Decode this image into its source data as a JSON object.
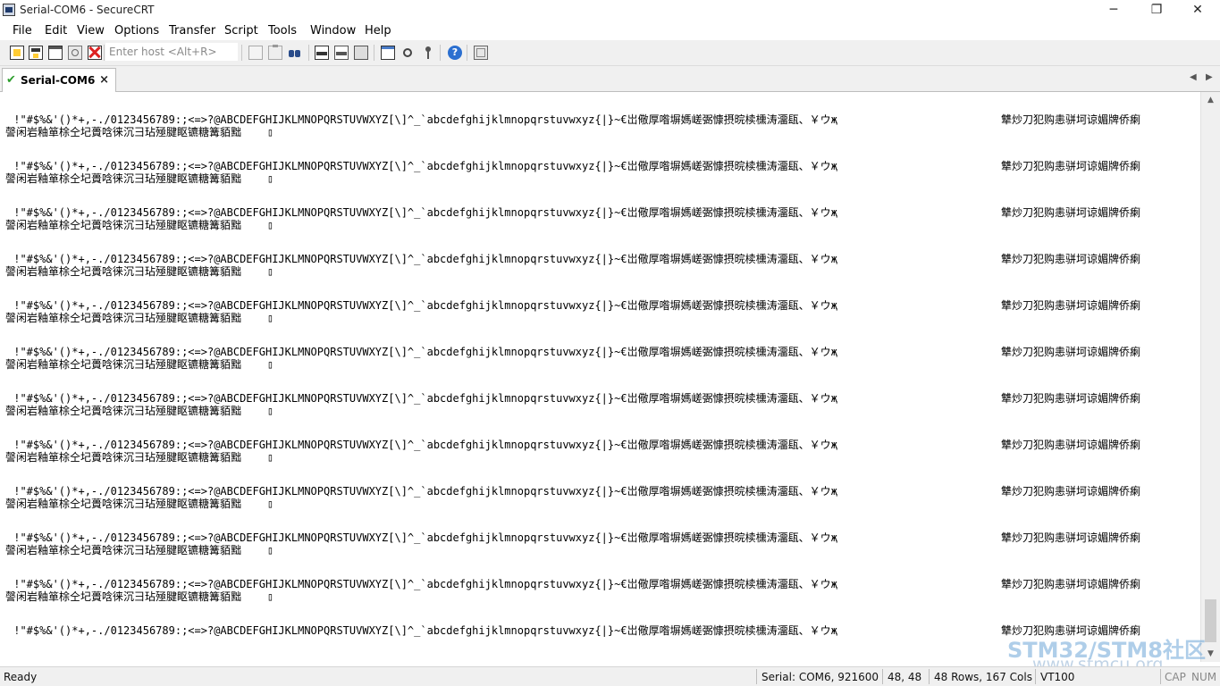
{
  "window": {
    "title": "Serial-COM6 - SecureCRT",
    "minimize": "─",
    "restore": "❐",
    "close": "✕"
  },
  "menu": [
    "File",
    "Edit",
    "View",
    "Options",
    "Transfer",
    "Script",
    "Tools",
    "Window",
    "Help"
  ],
  "toolbar": {
    "host_placeholder": "Enter host <Alt+R>",
    "icons": [
      "connect-icon",
      "quick-connect-icon",
      "connect-in-tab-icon",
      "reconnect-icon",
      "disconnect-icon",
      "copy-icon",
      "paste-icon",
      "find-icon",
      "print-icon",
      "print-selection-icon",
      "print-setup-icon",
      "session-options-icon",
      "global-options-icon",
      "keymap-icon",
      "help-icon",
      "sftp-icon"
    ]
  },
  "tabs": [
    {
      "label": "Serial-COM6",
      "close": "×",
      "status": "connected"
    }
  ],
  "tab_nav": {
    "prev": "◀",
    "next": "▶"
  },
  "terminal": {
    "line_ascii": " !\"#$%&'()*+,-./0123456789:;<=>?@ABCDEFGHIJKLMNOPQRSTUVWXYZ[\\]^_`abcdefghijklmnopqrstuvwxyz{|}~€岀儆厚喒塀媽嵯弻慷摂晥椟櫄涛澑瓺、￥ウҗ",
    "line_ascii_tail": "犨炒刀犯购恚骈坷谅媚牌侨瘌",
    "line_cjk": "謦闲岩釉箪梌仝圮蕢唅徕沉彐玷殛腱眍镳糖篝貊黜    ▯",
    "repeat_count": 12
  },
  "scrollbar": {
    "up": "▲",
    "down": "▼"
  },
  "status": {
    "ready": "Ready",
    "connection": "Serial: COM6, 921600",
    "cursor": "48,  48",
    "size": "48 Rows, 167 Cols",
    "emulation": "VT100",
    "caps": "CAP",
    "num": "NUM"
  },
  "watermark": {
    "line1": "STM32/STM8社区",
    "line2": "www.stmcu.org"
  }
}
